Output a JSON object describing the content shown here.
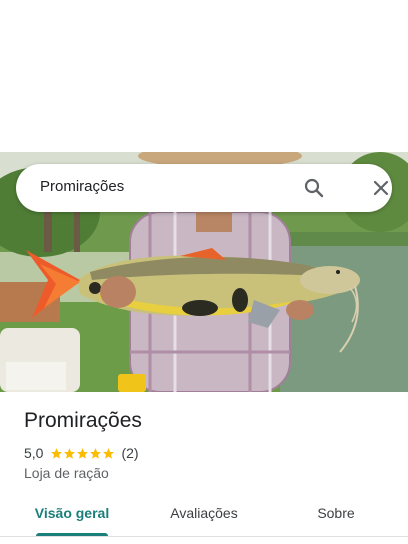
{
  "search": {
    "query": "Promirações"
  },
  "place": {
    "name": "Promirações",
    "rating": "5,0",
    "stars": 5,
    "review_count": "(2)",
    "category": "Loja de ração"
  },
  "tabs": [
    {
      "label": "Visão geral",
      "active": true
    },
    {
      "label": "Avaliações",
      "active": false
    },
    {
      "label": "Sobre",
      "active": false
    }
  ],
  "colors": {
    "accent": "#1a7f7a",
    "star": "#fbbc04"
  },
  "icons": {
    "search": "search-icon",
    "close": "close-icon",
    "star": "star-icon"
  }
}
